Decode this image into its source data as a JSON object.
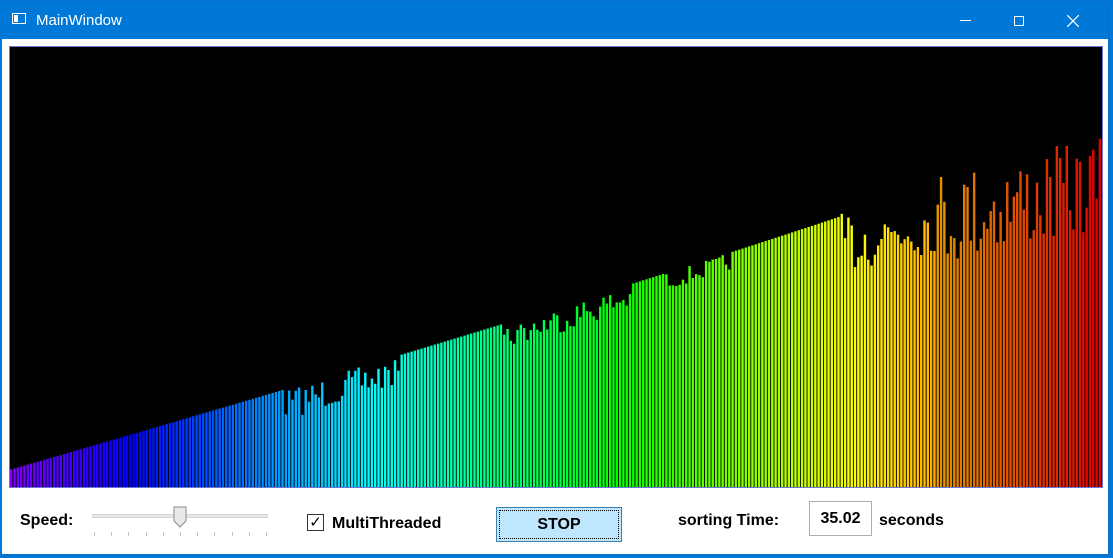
{
  "window": {
    "title": "MainWindow",
    "accent_color": "#0078d7",
    "controls": {
      "minimize": "minimize-icon",
      "maximize": "maximize-icon",
      "close": "close-icon"
    }
  },
  "visualization": {
    "background_color": "#000000",
    "bar_count": 330,
    "color_order": [
      "violet",
      "blue",
      "cyan",
      "green",
      "yellow",
      "orange",
      "red"
    ]
  },
  "controls": {
    "speed_label": "Speed:",
    "speed_value": 0.5,
    "multithreaded_label": "MultiThreaded",
    "multithreaded_checked": true,
    "check_mark": "✓",
    "stop_label": "STOP",
    "sorting_time_label": "sorting Time:",
    "sorting_time_value": "35.02",
    "seconds_label": "seconds"
  }
}
